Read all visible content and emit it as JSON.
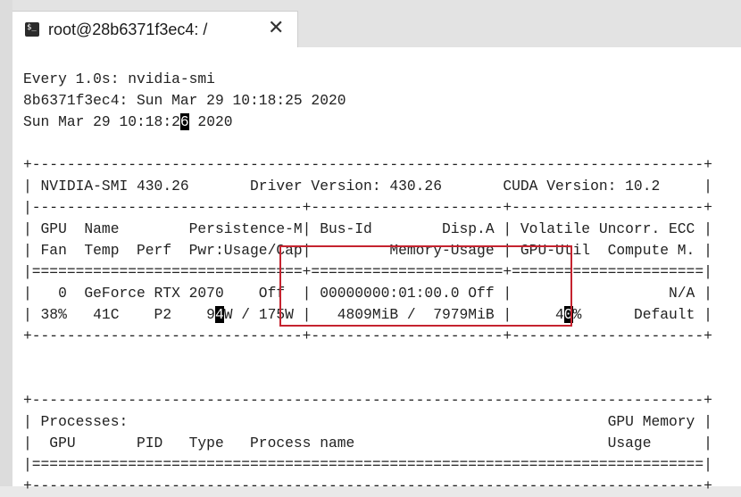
{
  "window": {
    "tab_title": "root@28b6371f3ec4: /",
    "tab_icon": "terminal-icon",
    "close_glyph": "✕"
  },
  "terminal": {
    "lines": [
      [
        "Every 1.0s: nvidia-smi"
      ],
      [
        "8b6371f3ec4: Sun Mar 29 10:18:25 2020"
      ],
      [
        "Sun Mar 29 10:18:2",
        {
          "cursor": "6"
        },
        " 2020"
      ],
      [
        ""
      ],
      [
        "+-----------------------------------------------------------------------------+"
      ],
      [
        "| NVIDIA-SMI 430.26       Driver Version: 430.26       CUDA Version: 10.2     |"
      ],
      [
        "|-------------------------------+----------------------+----------------------+"
      ],
      [
        "| GPU  Name        Persistence-M| Bus-Id        Disp.A | Volatile Uncorr. ECC |"
      ],
      [
        "| Fan  Temp  Perf  Pwr:Usage/Cap|         Memory-Usage | GPU-Util  Compute M. |"
      ],
      [
        "|===============================+======================+======================|"
      ],
      [
        "|   0  GeForce RTX 2070    Off  | 00000000:01:00.0 Off |                  N/A |"
      ],
      [
        "| 38%   41C    P2    9",
        {
          "cursor": "4"
        },
        "W / 175W |   4809MiB /  7979MiB |     4",
        {
          "cursor": "0"
        },
        "%      Default |"
      ],
      [
        "+-------------------------------+----------------------+----------------------+"
      ],
      [
        ""
      ],
      [
        ""
      ],
      [
        "+-----------------------------------------------------------------------------+"
      ],
      [
        "| Processes:                                                       GPU Memory |"
      ],
      [
        "|  GPU       PID   Type   Process name                             Usage      |"
      ],
      [
        "|=============================================================================|"
      ],
      [
        "+-----------------------------------------------------------------------------+"
      ]
    ]
  },
  "colors": {
    "highlight_border": "#c5232f",
    "terminal_bg": "#ffffff",
    "text": "#222222"
  }
}
